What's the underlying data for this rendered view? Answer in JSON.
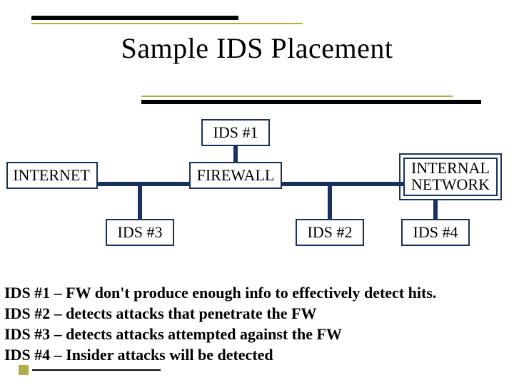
{
  "title": "Sample IDS Placement",
  "nodes": {
    "ids1": "IDS #1",
    "internet": "INTERNET",
    "firewall": "FIREWALL",
    "internal_network_l1": "INTERNAL",
    "internal_network_l2": "NETWORK",
    "ids3": "IDS #3",
    "ids2": "IDS #2",
    "ids4": "IDS #4"
  },
  "bullets": {
    "b1": "IDS #1 – FW don't produce enough info to effectively detect hits.",
    "b2": "IDS #2 – detects attacks that penetrate the FW",
    "b3": "IDS #3 – detects attacks attempted against the FW",
    "b4": "IDS #4 – Insider attacks will be detected"
  }
}
